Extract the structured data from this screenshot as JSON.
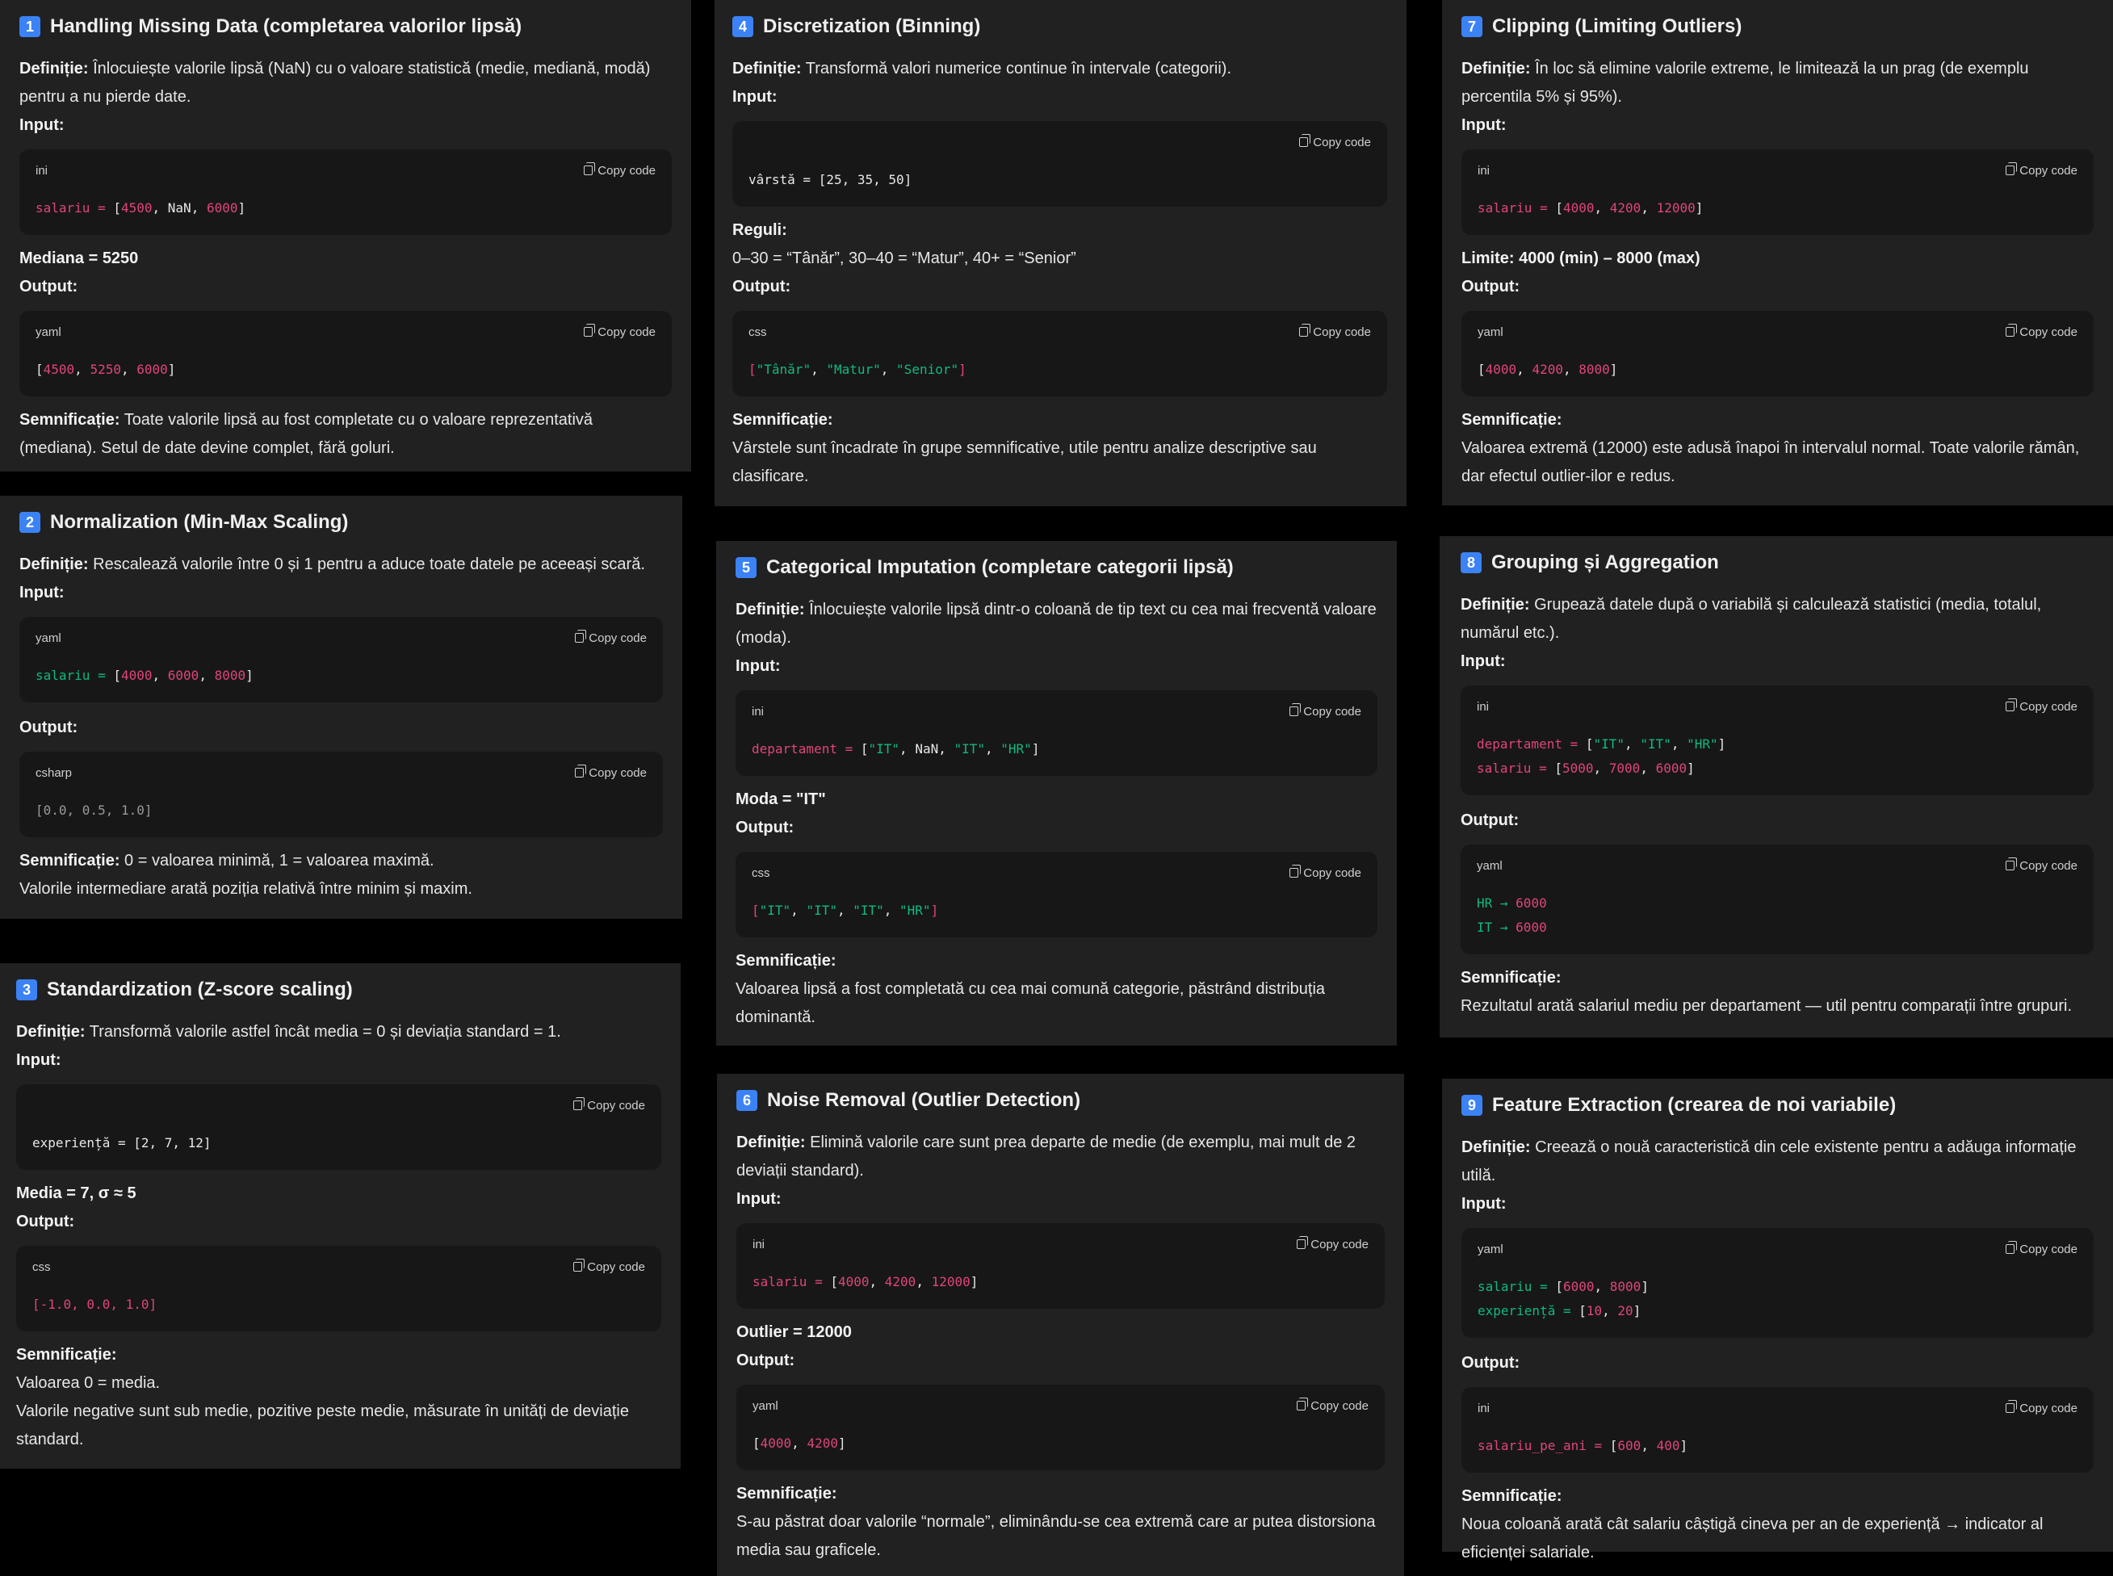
{
  "common": {
    "copy_label": "Copy code"
  },
  "cards": [
    {
      "num": "1",
      "title": "Handling Missing Data (completarea valorilor lipsă)",
      "def_label": "Definiție:",
      "def_text": "Înlocuiește valorile lipsă (NaN) cu o valoare statistică (medie, mediană, modă) pentru a nu pierde date.",
      "input_label": "Input:",
      "input_lang": "ini",
      "input_code": {
        "key": "salariu",
        "op": " = ",
        "open": "[",
        "v1": "4500",
        "sep1": ", ",
        "v2": "NaN",
        "sep2": ", ",
        "v3": "6000",
        "close": "]"
      },
      "extra": "Mediana = 5250",
      "output_label": "Output:",
      "output_lang": "yaml",
      "output_code": {
        "open": "[",
        "v1": "4500",
        "sep1": ", ",
        "v2": "5250",
        "sep2": ", ",
        "v3": "6000",
        "close": "]"
      },
      "sem_label": "Semnificație:",
      "sem_text": "Toate valorile lipsă au fost completate cu o valoare reprezentativă (mediana). Setul de date devine complet, fără goluri."
    },
    {
      "num": "2",
      "title": "Normalization (Min-Max Scaling)",
      "def_label": "Definiție:",
      "def_text": "Rescalează valorile între 0 și 1 pentru a aduce toate datele pe aceeași scară.",
      "input_label": "Input:",
      "input_lang": "yaml",
      "input_code": {
        "key": "salariu",
        "op": " = ",
        "open": "[",
        "v1": "4000",
        "sep1": ", ",
        "v2": "6000",
        "sep2": ", ",
        "v3": "8000",
        "close": "]"
      },
      "output_label": "Output:",
      "output_lang": "csharp",
      "output_code": "[0.0, 0.5, 1.0]",
      "sem_label": "Semnificație:",
      "sem_text": "0 = valoarea minimă, 1 = valoarea maximă.",
      "sem_text2": "Valorile intermediare arată poziția relativă între minim și maxim."
    },
    {
      "num": "3",
      "title": "Standardization (Z-score scaling)",
      "def_label": "Definiție:",
      "def_text": "Transformă valorile astfel încât media = 0 și deviația standard = 1.",
      "input_label": "Input:",
      "input_lang": "",
      "input_code": "experiență = [2, 7, 12]",
      "extra": "Media = 7, σ ≈ 5",
      "output_label": "Output:",
      "output_lang": "css",
      "output_code": "[-1.0, 0.0, 1.0]",
      "sem_label": "Semnificație:",
      "sem_text": "Valoarea 0 = media.",
      "sem_text2": "Valorile negative sunt sub medie, pozitive peste medie, măsurate în unități de deviație standard."
    },
    {
      "num": "4",
      "title": "Discretization (Binning)",
      "def_label": "Definiție:",
      "def_text": "Transformă valori numerice continue în intervale (categorii).",
      "input_label": "Input:",
      "input_lang": "",
      "input_code": "vârstă = [25, 35, 50]",
      "extra": "Reguli:",
      "extra2": "0–30 = “Tânăr”, 30–40 = “Matur”, 40+ = “Senior”",
      "output_label": "Output:",
      "output_lang": "css",
      "output_code": {
        "open": "[",
        "v1": "\"Tânăr\"",
        "sep1": ", ",
        "v2": "\"Matur\"",
        "sep2": ", ",
        "v3": "\"Senior\"",
        "close": "]"
      },
      "sem_label": "Semnificație:",
      "sem_text": "Vârstele sunt încadrate în grupe semnificative, utile pentru analize descriptive sau clasificare."
    },
    {
      "num": "5",
      "title": "Categorical Imputation (completare categorii lipsă)",
      "def_label": "Definiție:",
      "def_text": "Înlocuiește valorile lipsă dintr-o coloană de tip text cu cea mai frecventă valoare (moda).",
      "input_label": "Input:",
      "input_lang": "ini",
      "input_code": {
        "key": "departament",
        "op": " = ",
        "open": "[",
        "v1": "\"IT\"",
        "sep1": ", ",
        "v2": "NaN",
        "sep2": ", ",
        "v3": "\"IT\"",
        "sep3": ", ",
        "v4": "\"HR\"",
        "close": "]"
      },
      "extra": "Moda = \"IT\"",
      "output_label": "Output:",
      "output_lang": "css",
      "output_code": {
        "open": "[",
        "v1": "\"IT\"",
        "sep1": ", ",
        "v2": "\"IT\"",
        "sep2": ", ",
        "v3": "\"IT\"",
        "sep3": ", ",
        "v4": "\"HR\"",
        "close": "]"
      },
      "sem_label": "Semnificație:",
      "sem_text": "Valoarea lipsă a fost completată cu cea mai comună categorie, păstrând distribuția dominantă."
    },
    {
      "num": "6",
      "title": "Noise Removal (Outlier Detection)",
      "def_label": "Definiție:",
      "def_text": "Elimină valorile care sunt prea departe de medie (de exemplu, mai mult de 2 deviații standard).",
      "input_label": "Input:",
      "input_lang": "ini",
      "input_code": {
        "key": "salariu",
        "op": " = ",
        "open": "[",
        "v1": "4000",
        "sep1": ", ",
        "v2": "4200",
        "sep2": ", ",
        "v3": "12000",
        "close": "]"
      },
      "extra": "Outlier = 12000",
      "output_label": "Output:",
      "output_lang": "yaml",
      "output_code": {
        "open": "[",
        "v1": "4000",
        "sep1": ", ",
        "v2": "4200",
        "close": "]"
      },
      "sem_label": "Semnificație:",
      "sem_text": "S-au păstrat doar valorile “normale”, eliminându-se cea extremă care ar putea distorsiona media sau graficele."
    },
    {
      "num": "7",
      "title": "Clipping (Limiting Outliers)",
      "def_label": "Definiție:",
      "def_text": "În loc să elimine valorile extreme, le limitează la un prag (de exemplu percentila 5% și 95%).",
      "input_label": "Input:",
      "input_lang": "ini",
      "input_code": {
        "key": "salariu",
        "op": " = ",
        "open": "[",
        "v1": "4000",
        "sep1": ", ",
        "v2": "4200",
        "sep2": ", ",
        "v3": "12000",
        "close": "]"
      },
      "extra": "Limite: 4000 (min) – 8000 (max)",
      "output_label": "Output:",
      "output_lang": "yaml",
      "output_code": {
        "open": "[",
        "v1": "4000",
        "sep1": ", ",
        "v2": "4200",
        "sep2": ", ",
        "v3": "8000",
        "close": "]"
      },
      "sem_label": "Semnificație:",
      "sem_text": "Valoarea extremă (12000) este adusă înapoi în intervalul normal. Toate valorile rămân, dar efectul outlier-ilor e redus."
    },
    {
      "num": "8",
      "title": "Grouping și Aggregation",
      "def_label": "Definiție:",
      "def_text": "Grupează datele după o variabilă și calculează statistici (media, totalul, numărul etc.).",
      "input_label": "Input:",
      "input_lang": "ini",
      "input_line1": {
        "key": "departament",
        "op": " = ",
        "open": "[",
        "v1": "\"IT\"",
        "sep1": ", ",
        "v2": "\"IT\"",
        "sep2": ", ",
        "v3": "\"HR\"",
        "close": "]"
      },
      "input_line2": {
        "key": "salariu",
        "op": " = ",
        "open": "[",
        "v1": "5000",
        "sep1": ", ",
        "v2": "7000",
        "sep2": ", ",
        "v3": "6000",
        "close": "]"
      },
      "output_label": "Output:",
      "output_lang": "yaml",
      "output_line1": {
        "key": "HR",
        "arrow": " → ",
        "val": "6000"
      },
      "output_line2": {
        "key": "IT",
        "arrow": " → ",
        "val": "6000"
      },
      "sem_label": "Semnificație:",
      "sem_text": "Rezultatul arată salariul mediu per departament — util pentru comparații între grupuri."
    },
    {
      "num": "9",
      "title": "Feature Extraction (crearea de noi variabile)",
      "def_label": "Definiție:",
      "def_text": "Creează o nouă caracteristică din cele existente pentru a adăuga informație utilă.",
      "input_label": "Input:",
      "input_lang": "yaml",
      "input_line1": {
        "key": "salariu",
        "op": " = ",
        "open": "[",
        "v1": "6000",
        "sep1": ", ",
        "v2": "8000",
        "close": "]"
      },
      "input_line2": {
        "key": "experiență",
        "op": " = ",
        "open": "[",
        "v1": "10",
        "sep1": ", ",
        "v2": "20",
        "close": "]"
      },
      "output_label": "Output:",
      "output_lang": "ini",
      "output_code": {
        "key": "salariu_pe_ani",
        "op": " = ",
        "open": "[",
        "v1": "600",
        "sep1": ", ",
        "v2": "400",
        "close": "]"
      },
      "sem_label": "Semnificație:",
      "sem_text": "Noua coloană arată cât salariu câștigă cineva per an de experiență → indicator al eficienței salariale."
    }
  ]
}
